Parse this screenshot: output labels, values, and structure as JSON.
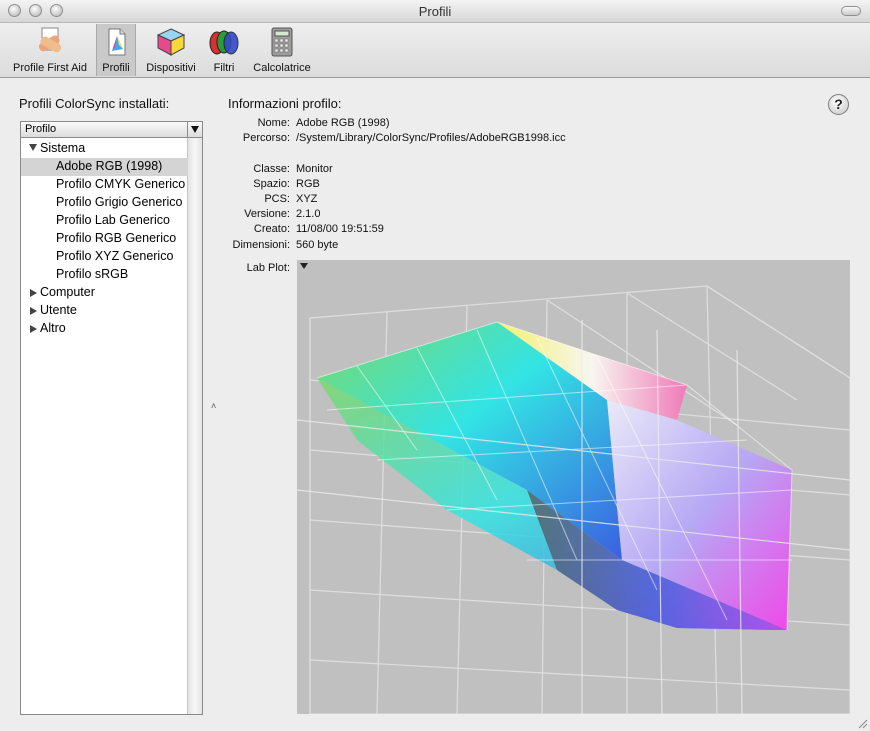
{
  "window": {
    "title": "Profili"
  },
  "toolbar": {
    "items": [
      {
        "label": "Profile First Aid",
        "icon": "first-aid-icon"
      },
      {
        "label": "Profili",
        "icon": "profile-icon",
        "selected": true
      },
      {
        "label": "Dispositivi",
        "icon": "device-cube-icon"
      },
      {
        "label": "Filtri",
        "icon": "filter-icon"
      },
      {
        "label": "Calcolatrice",
        "icon": "calculator-icon"
      }
    ]
  },
  "sidebar": {
    "title": "Profili ColorSync installati:",
    "column_header": "Profilo",
    "groups": [
      {
        "label": "Sistema",
        "expanded": true,
        "items": [
          "Adobe RGB (1998)",
          "Profilo CMYK Generico",
          "Profilo Grigio Generico",
          "Profilo Lab Generico",
          "Profilo RGB Generico",
          "Profilo XYZ Generico",
          "Profilo sRGB"
        ]
      },
      {
        "label": "Computer",
        "expanded": false
      },
      {
        "label": "Utente",
        "expanded": false
      },
      {
        "label": "Altro",
        "expanded": false
      }
    ],
    "selected_item": "Adobe RGB (1998)"
  },
  "info": {
    "title": "Informazioni profilo:",
    "help_label": "?",
    "fields": {
      "name_label": "Nome:",
      "name": "Adobe RGB (1998)",
      "path_label": "Percorso:",
      "path": "/System/Library/ColorSync/Profiles/AdobeRGB1998.icc",
      "class_label": "Classe:",
      "class": "Monitor",
      "space_label": "Spazio:",
      "space": "RGB",
      "pcs_label": "PCS:",
      "pcs": "XYZ",
      "version_label": "Versione:",
      "version": "2.1.0",
      "created_label": "Creato:",
      "created": "11/08/00 19:51:59",
      "size_label": "Dimensioni:",
      "size": "560 byte"
    },
    "plot_label": "Lab Plot:"
  },
  "colors": {
    "selection": "#d4d4d4",
    "plot_bg": "#c0c0c0"
  }
}
